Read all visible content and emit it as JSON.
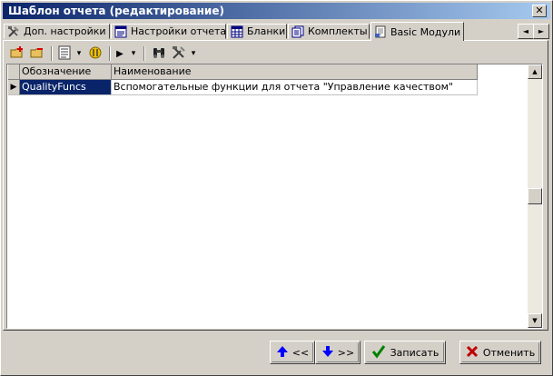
{
  "window": {
    "title": "Шаблон отчета (редактирование)",
    "close_glyph": "✕"
  },
  "tabs": [
    {
      "label": "Доп. настройки",
      "icon": "tools-icon"
    },
    {
      "label": "Настройки отчета",
      "icon": "report-settings-icon"
    },
    {
      "label": "Бланки",
      "icon": "grid-icon"
    },
    {
      "label": "Комплекты",
      "icon": "sets-icon"
    },
    {
      "label": "Basic Модули",
      "icon": "module-icon",
      "active": true
    }
  ],
  "tab_scroll": {
    "left": "◄",
    "right": "►"
  },
  "toolbar": {
    "dropdown_glyph": "▾",
    "play_glyph": "▶",
    "binoculars_glyph": "👓"
  },
  "grid": {
    "columns": [
      "Обозначение",
      "Наименование"
    ],
    "rows": [
      {
        "indicator": "▶",
        "code": "QualityFuncs",
        "name": "Вспомогательные функции для отчета \"Управление качеством\""
      }
    ],
    "scroll_up": "▲",
    "scroll_down": "▼"
  },
  "buttons": {
    "prev_label": "<<",
    "next_label": ">>",
    "save_label": "Записать",
    "cancel_label": "Отменить"
  },
  "colors": {
    "title_start": "#0a246a",
    "title_end": "#a6caf0",
    "selection": "#0a246a",
    "ok": "#008000",
    "cancel": "#c00000",
    "arrow": "#0000ff"
  }
}
